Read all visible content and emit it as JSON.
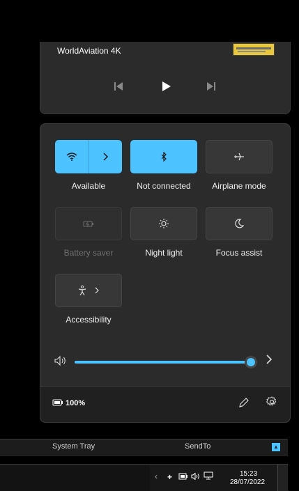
{
  "media": {
    "title": "WorldAviation 4K",
    "prev_icon": "previous-track-icon",
    "play_icon": "play-icon",
    "next_icon": "next-track-icon"
  },
  "quick_settings": {
    "tiles": [
      {
        "id": "wifi",
        "label": "Available",
        "state": "on",
        "icon": "wifi-icon"
      },
      {
        "id": "bluetooth",
        "label": "Not connected",
        "state": "on",
        "icon": "bluetooth-icon"
      },
      {
        "id": "airplane",
        "label": "Airplane mode",
        "state": "off",
        "icon": "airplane-icon"
      },
      {
        "id": "battery_saver",
        "label": "Battery saver",
        "state": "disabled",
        "icon": "battery-saver-icon"
      },
      {
        "id": "night_light",
        "label": "Night light",
        "state": "off",
        "icon": "sun-icon"
      },
      {
        "id": "focus_assist",
        "label": "Focus assist",
        "state": "off",
        "icon": "moon-icon"
      },
      {
        "id": "accessibility",
        "label": "Accessibility",
        "state": "off",
        "icon": "accessibility-icon"
      }
    ],
    "volume": {
      "level": 0.98,
      "icon": "speaker-icon"
    },
    "footer": {
      "battery_percent": "100%",
      "edit_icon": "pencil-icon",
      "settings_icon": "gear-icon"
    }
  },
  "toolbar": {
    "system_tray": "System Tray",
    "send_to": "SendTo"
  },
  "taskbar": {
    "time": "15:23",
    "date": "28/07/2022"
  },
  "colors": {
    "accent": "#4cc2ff",
    "panel": "#2b2b2b",
    "footer": "#202020"
  }
}
